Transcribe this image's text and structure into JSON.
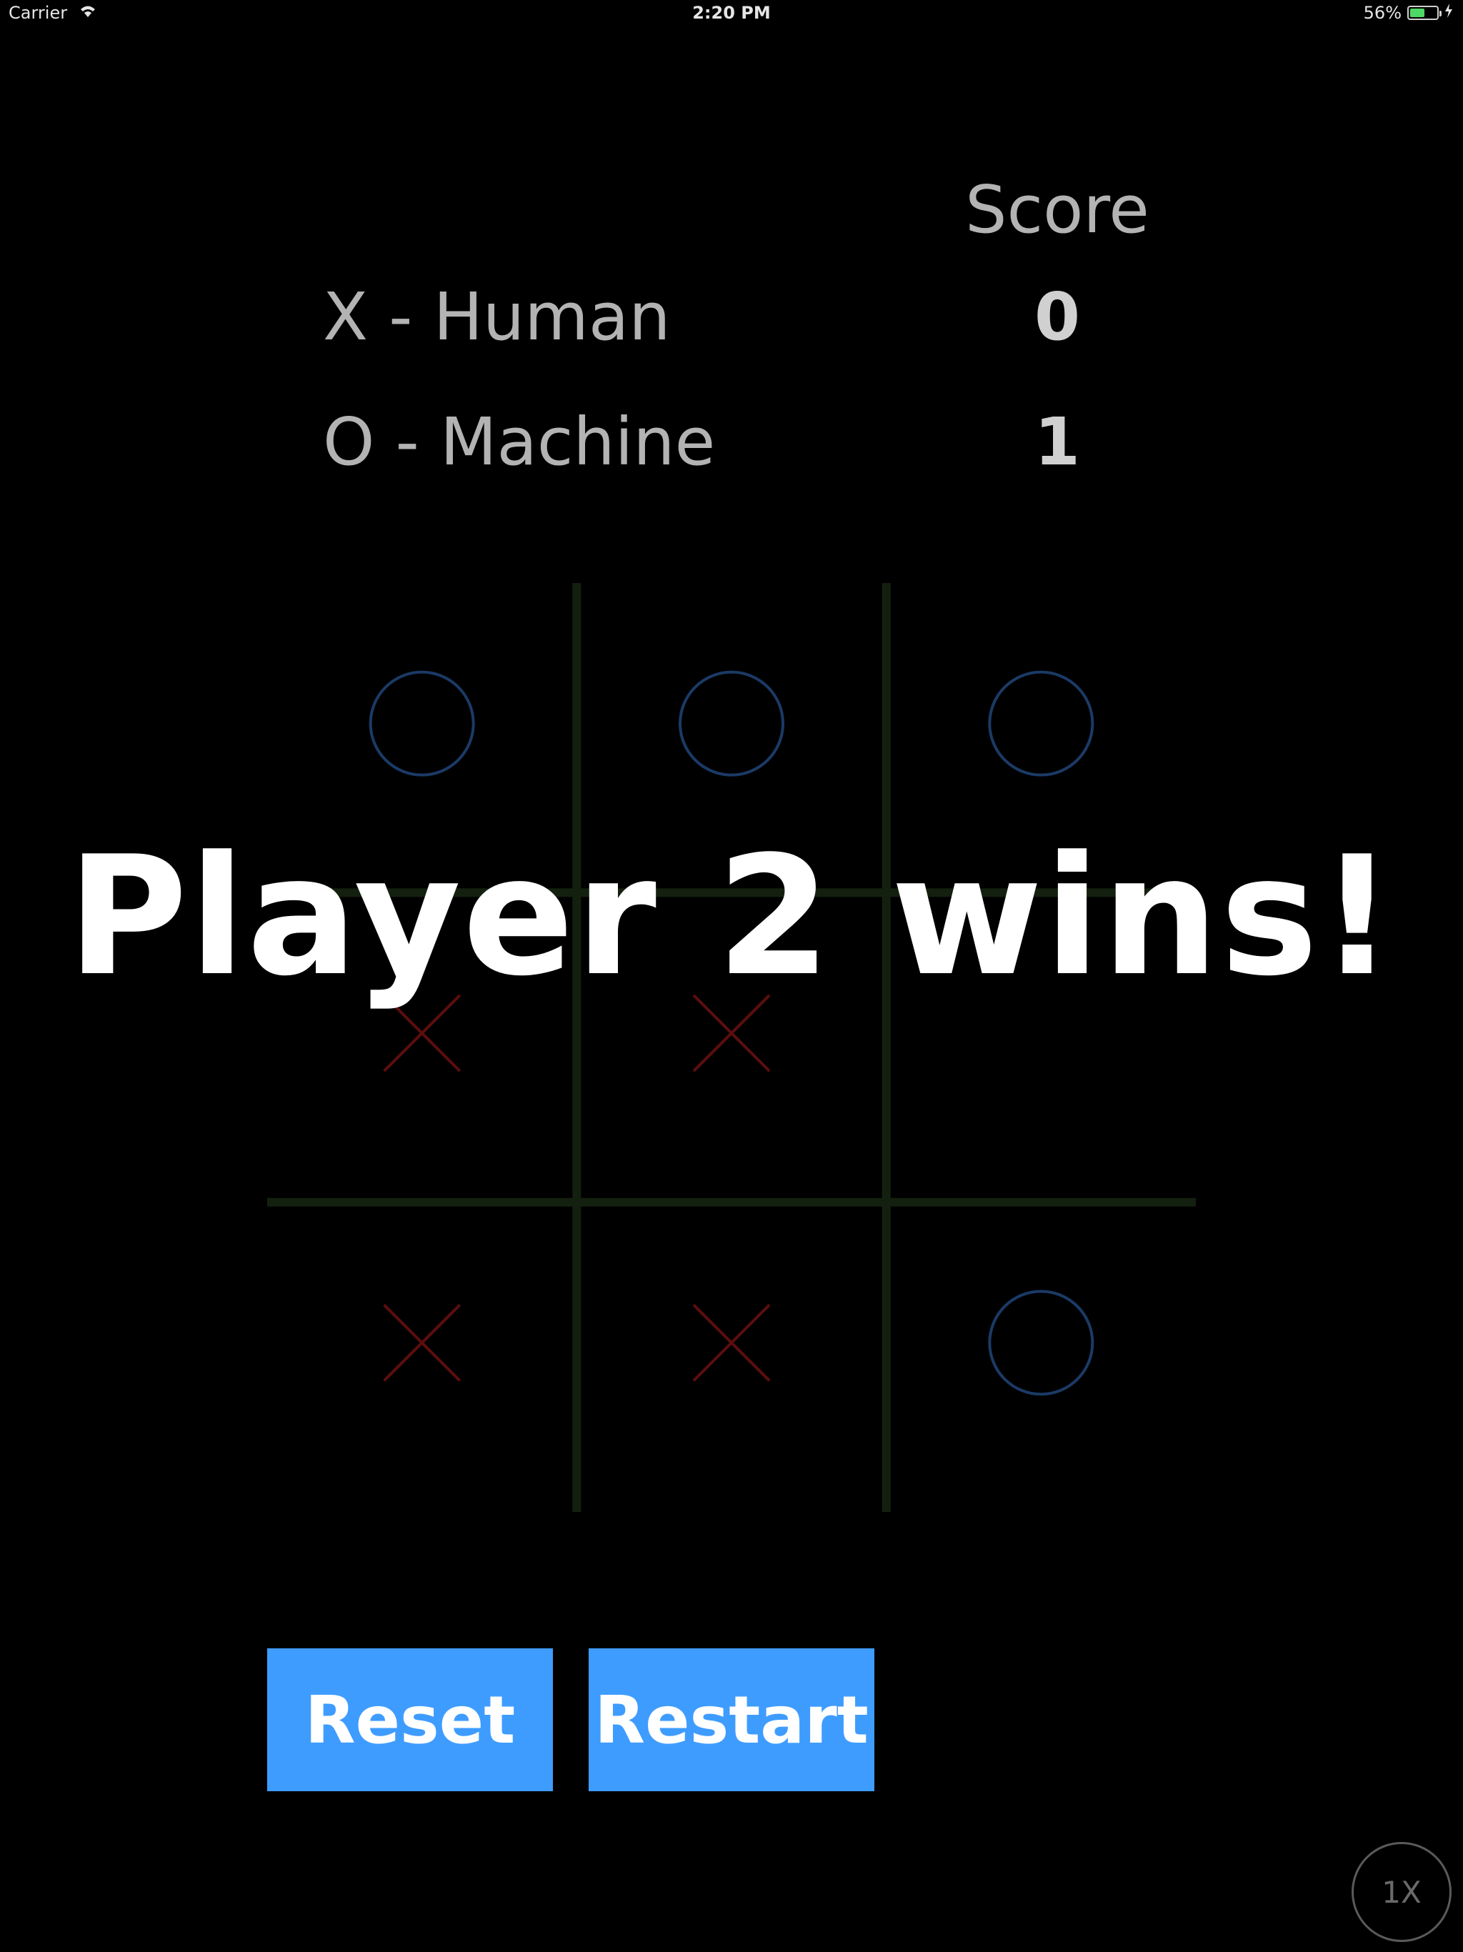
{
  "status_bar": {
    "carrier": "Carrier",
    "time": "2:20 PM",
    "battery_percent": "56%",
    "battery_level": 0.56,
    "icons": [
      "wifi-icon",
      "battery-icon",
      "charging-icon"
    ]
  },
  "score": {
    "header": "Score",
    "players": [
      {
        "label": "X - Human",
        "score": "0"
      },
      {
        "label": "O - Machine",
        "score": "1"
      }
    ]
  },
  "board": {
    "cells": [
      [
        "O",
        "O",
        "O"
      ],
      [
        "X",
        "X",
        ""
      ],
      [
        "X",
        "X",
        "O"
      ]
    ],
    "colors": {
      "grid": "#14200f",
      "x_mark": "#5c0e0e",
      "o_mark": "#1b3a66"
    }
  },
  "overlay": {
    "message": "Player 2 wins!"
  },
  "buttons": {
    "reset_label": "Reset",
    "restart_label": "Restart",
    "color": "#3f9cff"
  },
  "zoom": {
    "label": "1X"
  }
}
